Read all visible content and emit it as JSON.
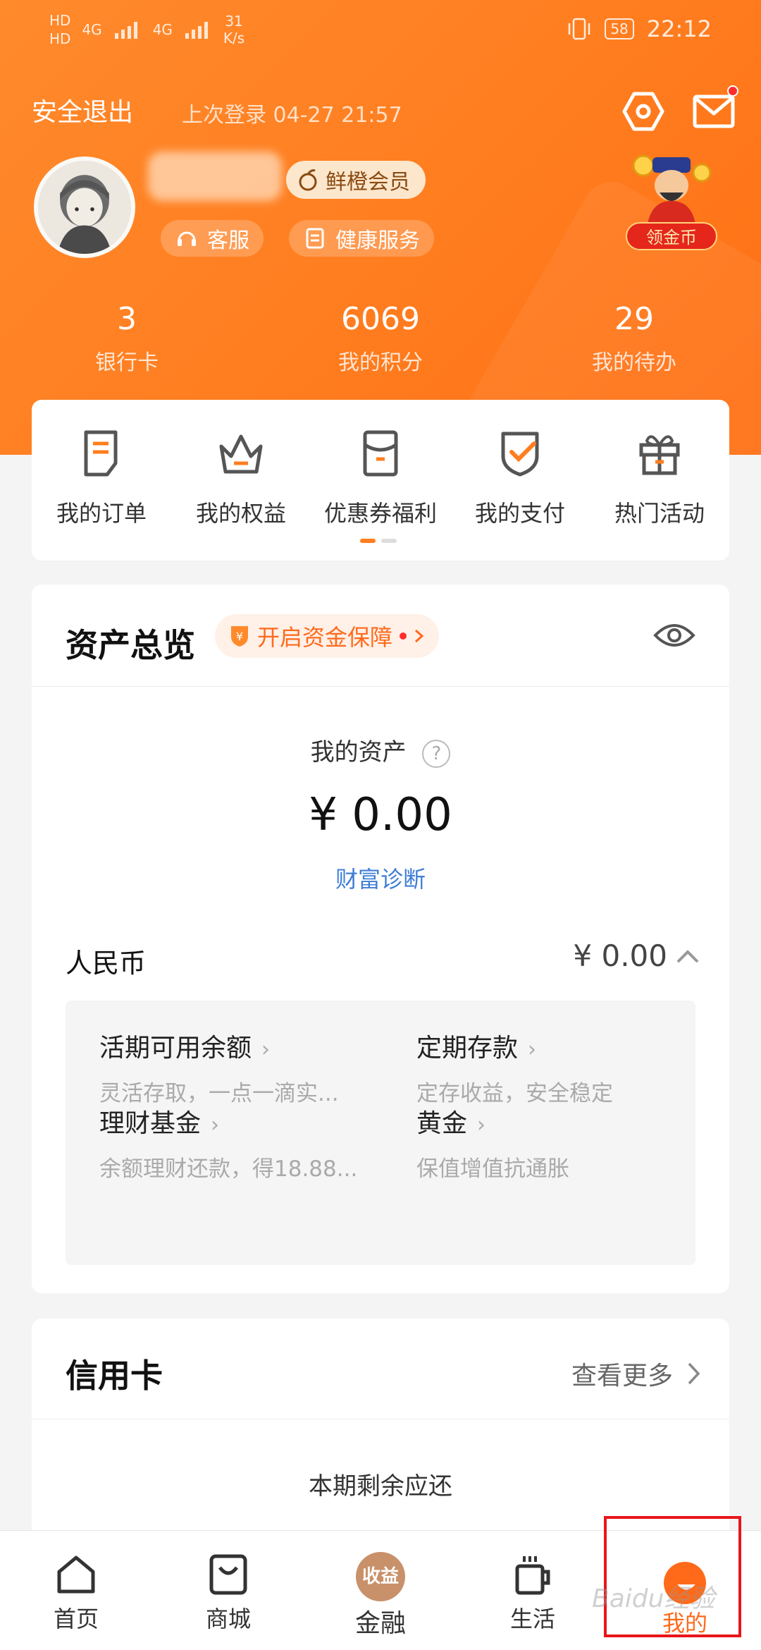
{
  "status_bar": {
    "left_label_1": "HD",
    "left_label_2": "HD",
    "net_1": "4G",
    "net_2": "4G",
    "speed": "31\nK/s",
    "battery": "58",
    "time": "22:12"
  },
  "header": {
    "logout": "安全退出",
    "last_login": "上次登录 04-27 21:57",
    "member_label": "鲜橙会员",
    "service_label": "客服",
    "health_label": "健康服务",
    "coin_label": "领金币"
  },
  "stats": [
    {
      "value": "3",
      "label": "银行卡"
    },
    {
      "value": "6069",
      "label": "我的积分"
    },
    {
      "value": "29",
      "label": "我的待办"
    }
  ],
  "shortcuts": [
    {
      "label": "我的订单",
      "icon": "order-icon"
    },
    {
      "label": "我的权益",
      "icon": "crown-icon"
    },
    {
      "label": "优惠券福利",
      "icon": "coupon-icon"
    },
    {
      "label": "我的支付",
      "icon": "shield-check-icon"
    },
    {
      "label": "热门活动",
      "icon": "gift-icon"
    }
  ],
  "assets": {
    "title": "资产总览",
    "protect_label": "开启资金保障",
    "my_asset_label": "我的资产",
    "amount": "¥ 0.00",
    "diagnosis": "财富诊断",
    "currency_label": "人民币",
    "currency_amount": "¥ 0.00",
    "items": [
      {
        "title": "活期可用余额",
        "sub": "灵活存取，一点一滴实..."
      },
      {
        "title": "定期存款",
        "sub": "定存收益，安全稳定"
      },
      {
        "title": "理财基金",
        "sub": "余额理财还款，得18.88..."
      },
      {
        "title": "黄金",
        "sub": "保值增值抗通胀"
      }
    ],
    "arrow": "›"
  },
  "credit": {
    "title": "信用卡",
    "more": "查看更多",
    "due_label": "本期剩余应还"
  },
  "bottom_nav": [
    {
      "label": "首页",
      "icon": "home-icon"
    },
    {
      "label": "商城",
      "icon": "shop-bag-icon"
    },
    {
      "label": "金融",
      "badge": "收益"
    },
    {
      "label": "生活",
      "icon": "cup-icon"
    },
    {
      "label": "我的",
      "icon": "mine-icon"
    }
  ],
  "watermark": "Baidu经验",
  "colors": {
    "brand_orange": "#ff7d1f",
    "link_blue": "#3f7ed6",
    "highlight_red": "#e8161b"
  }
}
